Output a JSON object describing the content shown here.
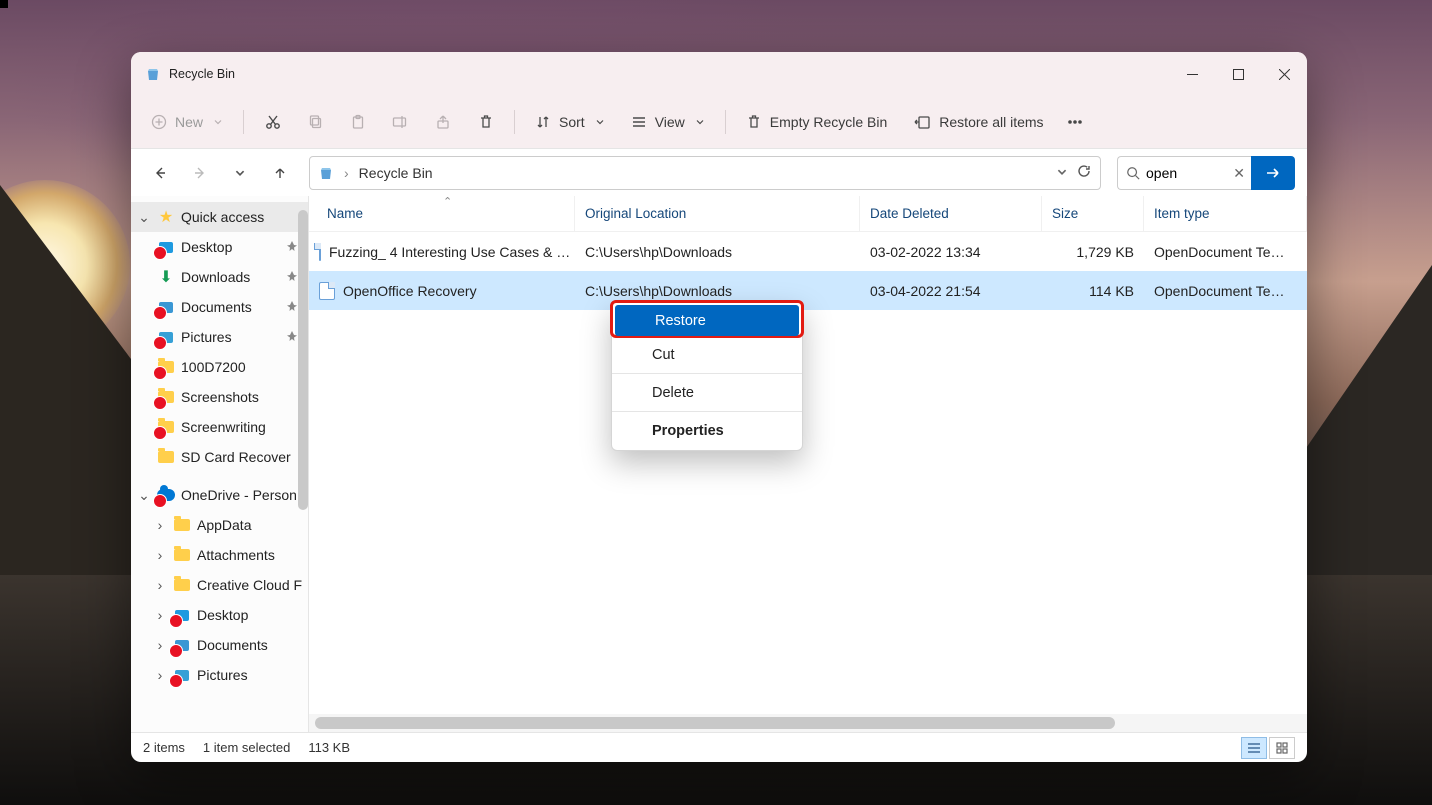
{
  "window": {
    "title": "Recycle Bin"
  },
  "toolbar": {
    "new": "New",
    "sort": "Sort",
    "view": "View",
    "empty": "Empty Recycle Bin",
    "restore_all": "Restore all items"
  },
  "addressbar": {
    "location": "Recycle Bin"
  },
  "search": {
    "value": "open"
  },
  "sidebar": {
    "quick_access": "Quick access",
    "qa_items": [
      {
        "label": "Desktop",
        "pin": true,
        "redx": true,
        "icon": "desktop"
      },
      {
        "label": "Downloads",
        "pin": true,
        "redx": false,
        "icon": "download"
      },
      {
        "label": "Documents",
        "pin": true,
        "redx": true,
        "icon": "documents"
      },
      {
        "label": "Pictures",
        "pin": true,
        "redx": true,
        "icon": "pictures"
      },
      {
        "label": "100D7200",
        "pin": false,
        "redx": true,
        "icon": "folder"
      },
      {
        "label": "Screenshots",
        "pin": false,
        "redx": true,
        "icon": "folder"
      },
      {
        "label": "Screenwriting",
        "pin": false,
        "redx": true,
        "icon": "folder"
      },
      {
        "label": "SD Card Recover",
        "pin": false,
        "redx": false,
        "icon": "folder"
      }
    ],
    "onedrive": "OneDrive - Person",
    "od_items": [
      {
        "label": "AppData"
      },
      {
        "label": "Attachments"
      },
      {
        "label": "Creative Cloud F"
      },
      {
        "label": "Desktop",
        "redx": true,
        "icon": "desktop"
      },
      {
        "label": "Documents",
        "redx": true,
        "icon": "documents"
      },
      {
        "label": "Pictures",
        "redx": true,
        "icon": "pictures"
      }
    ]
  },
  "columns": {
    "name": "Name",
    "loc": "Original Location",
    "date": "Date Deleted",
    "size": "Size",
    "type": "Item type"
  },
  "rows": [
    {
      "name": "Fuzzing_ 4 Interesting Use Cases & …",
      "loc": "C:\\Users\\hp\\Downloads",
      "date": "03-02-2022 13:34",
      "size": "1,729 KB",
      "type": "OpenDocument Te…",
      "selected": false
    },
    {
      "name": "OpenOffice Recovery",
      "loc": "C:\\Users\\hp\\Downloads",
      "date": "03-04-2022 21:54",
      "size": "114 KB",
      "type": "OpenDocument Te…",
      "selected": true
    }
  ],
  "context_menu": {
    "restore": "Restore",
    "cut": "Cut",
    "delete": "Delete",
    "properties": "Properties"
  },
  "status": {
    "count": "2 items",
    "selected": "1 item selected",
    "size": "113 KB"
  }
}
